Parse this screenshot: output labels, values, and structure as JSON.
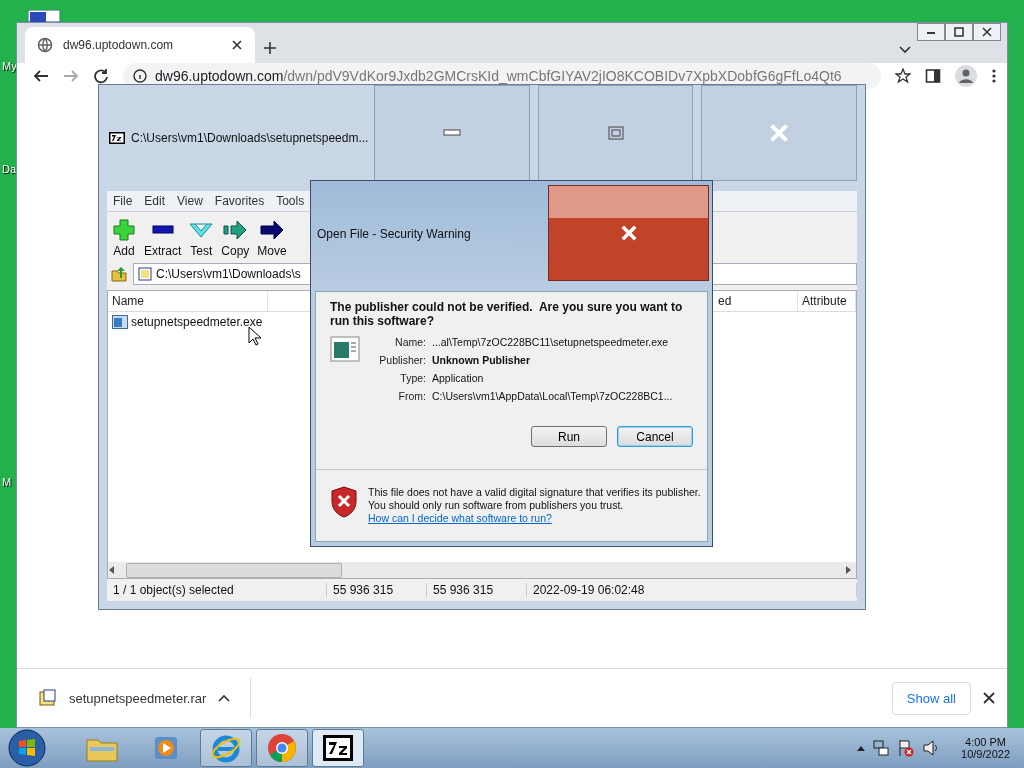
{
  "desktop": {
    "icon_labels": [
      "My",
      "Da",
      "M"
    ]
  },
  "browser": {
    "tabs": [
      {
        "title": "dw96.uptodown.com",
        "selected": true
      }
    ],
    "address_host": "dw96.uptodown.com",
    "address_path": "/dwn/pdV9VdKor9Jxdb2GMCrsKId_wmCbfGIYAV2jIO8KCOBIDv7XpbXDobfG6gFfLo4Qt6",
    "download_file": "setupnetspeedmeter.rar",
    "show_all": "Show all"
  },
  "archive_window": {
    "title": "C:\\Users\\vm1\\Downloads\\setupnetspeedm...",
    "menu": [
      "File",
      "Edit",
      "View",
      "Favorites",
      "Tools"
    ],
    "toolbar": [
      {
        "label": "Add",
        "kind": "add"
      },
      {
        "label": "Extract",
        "kind": "extract"
      },
      {
        "label": "Test",
        "kind": "test"
      },
      {
        "label": "Copy",
        "kind": "copy"
      },
      {
        "label": "Move",
        "kind": "move"
      }
    ],
    "path": "C:\\Users\\vm1\\Downloads\\s",
    "columns": [
      "Name",
      "ed",
      "Attribute"
    ],
    "rows": [
      {
        "name": "setupnetspeedmeter.exe"
      }
    ],
    "status": [
      "1 / 1 object(s) selected",
      "55 936 315",
      "55 936 315",
      "2022-09-19 06:02:48"
    ]
  },
  "dialog": {
    "title": "Open File - Security Warning",
    "heading": "The publisher could not be verified.  Are you sure you want to run this software?",
    "fields": [
      {
        "label": "Name:",
        "value": "...al\\Temp\\7zOC228BC11\\setupnetspeedmeter.exe",
        "kind": "plain"
      },
      {
        "label": "Publisher:",
        "value": "Unknown Publisher",
        "kind": "bold"
      },
      {
        "label": "Type:",
        "value": "Application",
        "kind": "plain"
      },
      {
        "label": "From:",
        "value": "C:\\Users\\vm1\\AppData\\Local\\Temp\\7zOC228BC1...",
        "kind": "plain"
      }
    ],
    "buttons": [
      {
        "label": "Run",
        "focused": false
      },
      {
        "label": "Cancel",
        "focused": true
      }
    ],
    "warning": "This file does not have a valid digital signature that verifies its publisher.  You should only run software from publishers you trust.",
    "help_link": "How can I decide what software to run?"
  },
  "taskbar": {
    "apps": [
      {
        "kind": "explorer",
        "running": false,
        "selected": false
      },
      {
        "kind": "media",
        "running": false,
        "selected": false
      },
      {
        "kind": "ie",
        "running": true,
        "selected": false
      },
      {
        "kind": "chrome",
        "running": true,
        "selected": false
      },
      {
        "kind": "sevenzip",
        "running": true,
        "selected": true
      }
    ],
    "time": "4:00 PM",
    "date": "10/9/2022"
  }
}
